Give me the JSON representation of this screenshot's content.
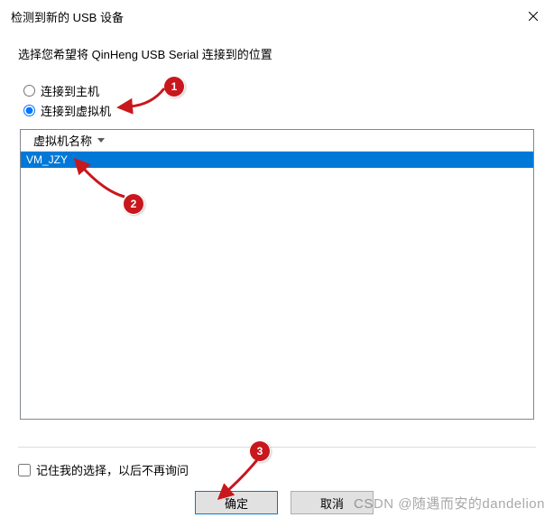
{
  "window": {
    "title": "检测到新的 USB 设备"
  },
  "prompt": "选择您希望将 QinHeng USB Serial 连接到的位置",
  "radios": {
    "host": "连接到主机",
    "vm": "连接到虚拟机"
  },
  "list": {
    "header": "虚拟机名称",
    "items": [
      "VM_JZY"
    ]
  },
  "remember": "记住我的选择，以后不再询问",
  "buttons": {
    "ok": "确定",
    "cancel": "取消"
  },
  "annotations": {
    "b1": "1",
    "b2": "2",
    "b3": "3"
  },
  "watermark": "CSDN @随遇而安的dandelion"
}
